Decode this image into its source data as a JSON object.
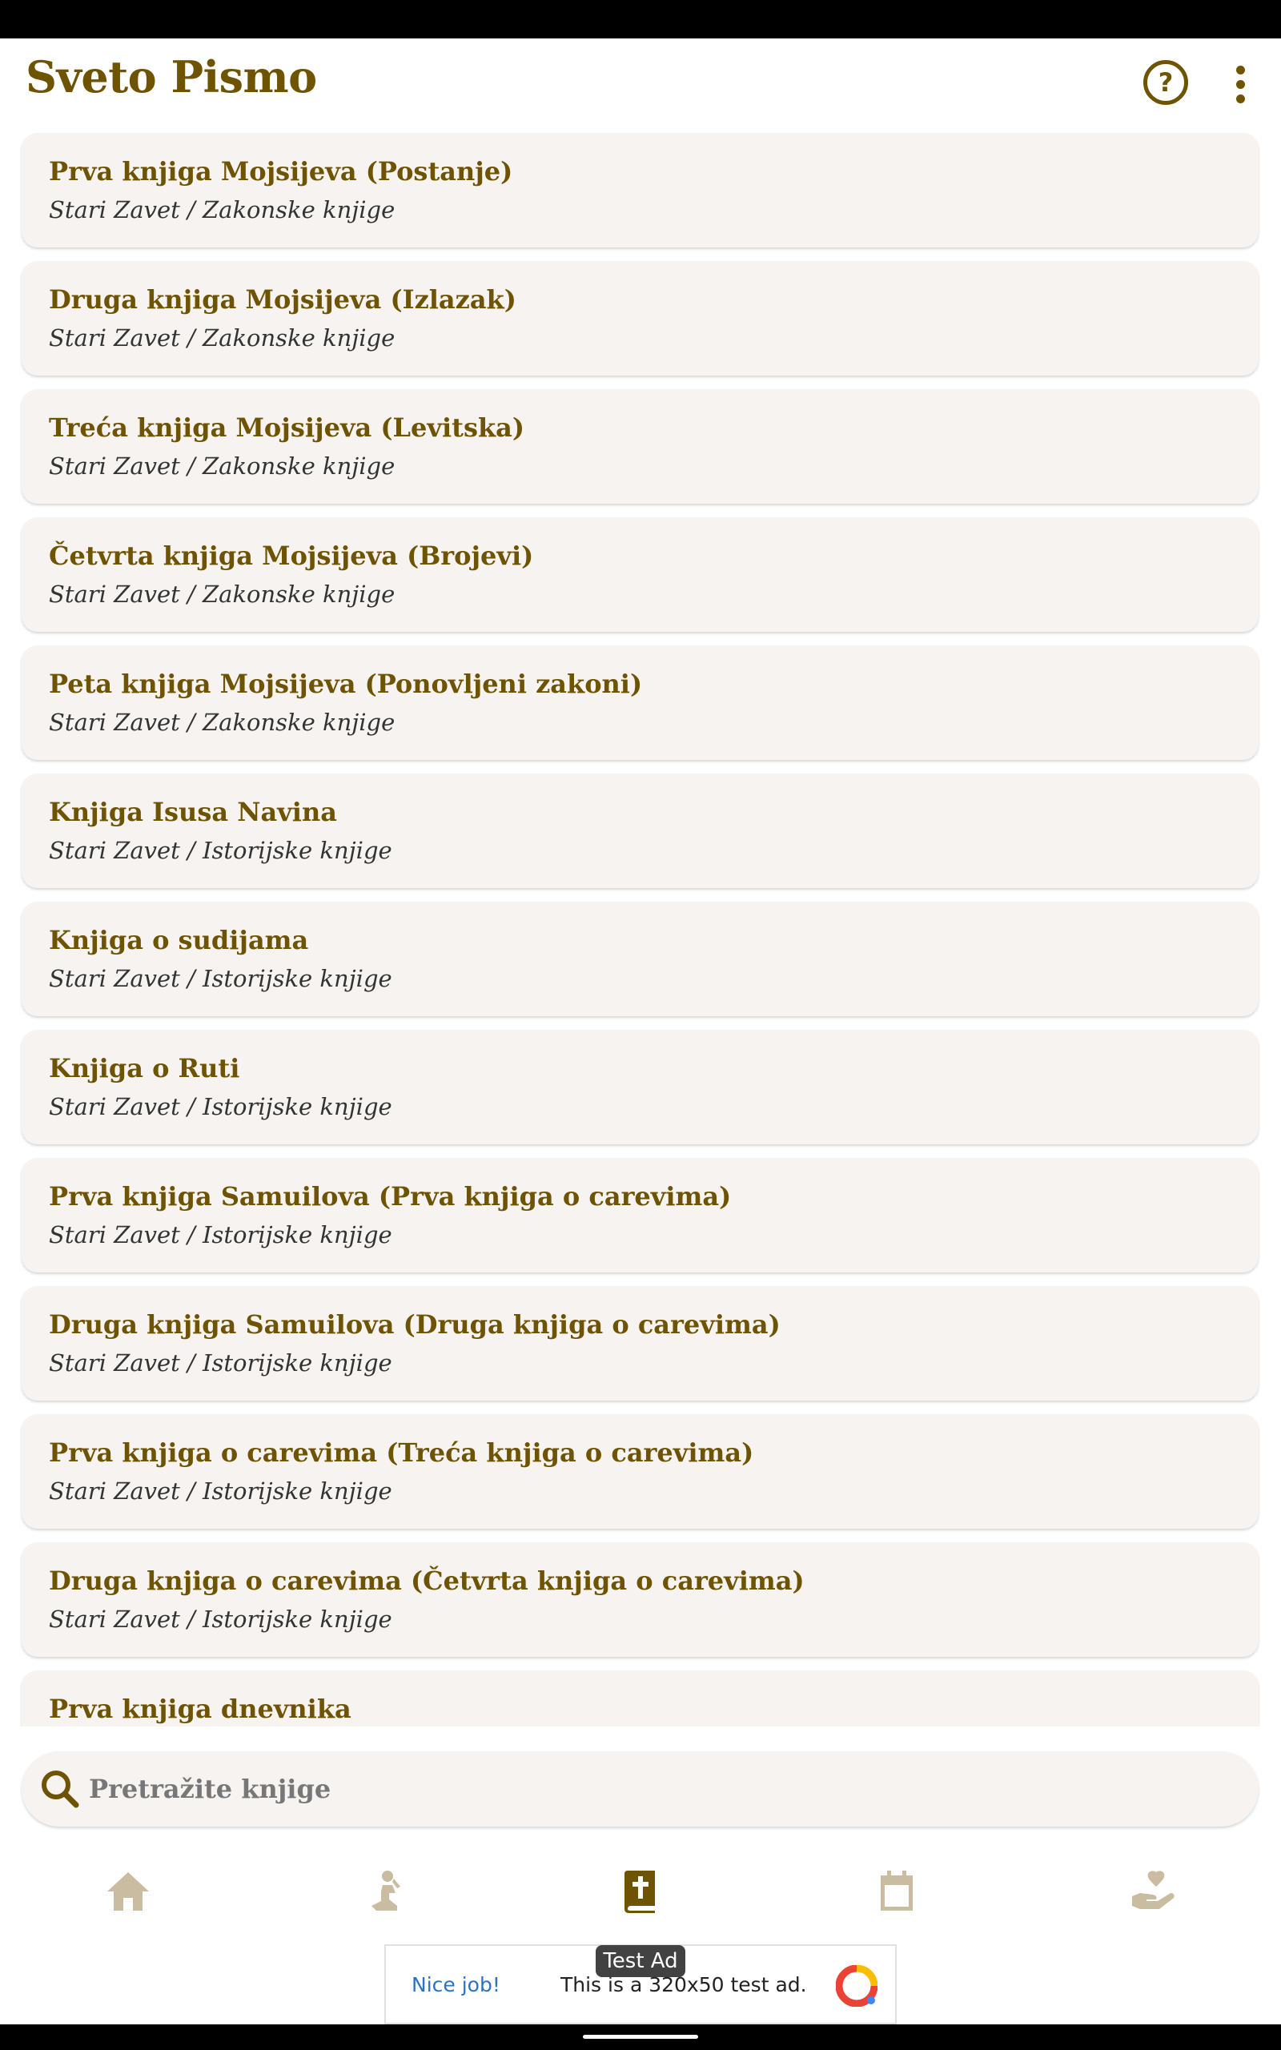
{
  "app_bar": {
    "title": "Sveto Pismo",
    "help_icon": "help-circle-icon",
    "more_icon": "more-vertical-icon"
  },
  "books": [
    {
      "title": "Prva knjiga Mojsijeva (Postanje)",
      "subtitle": "Stari Zavet / Zakonske knjige"
    },
    {
      "title": "Druga knjiga Mojsijeva (Izlazak)",
      "subtitle": "Stari Zavet / Zakonske knjige"
    },
    {
      "title": "Treća knjiga Mojsijeva (Levitska)",
      "subtitle": "Stari Zavet / Zakonske knjige"
    },
    {
      "title": "Četvrta knjiga Mojsijeva (Brojevi)",
      "subtitle": "Stari Zavet / Zakonske knjige"
    },
    {
      "title": "Peta knjiga Mojsijeva (Ponovljeni zakoni)",
      "subtitle": "Stari Zavet / Zakonske knjige"
    },
    {
      "title": "Knjiga Isusa Navina",
      "subtitle": "Stari Zavet / Istorijske knjige"
    },
    {
      "title": "Knjiga o sudijama",
      "subtitle": "Stari Zavet / Istorijske knjige"
    },
    {
      "title": "Knjiga o Ruti",
      "subtitle": "Stari Zavet / Istorijske knjige"
    },
    {
      "title": "Prva knjiga Samuilova (Prva knjiga o carevima)",
      "subtitle": "Stari Zavet / Istorijske knjige"
    },
    {
      "title": "Druga knjiga Samuilova (Druga knjiga o carevima)",
      "subtitle": "Stari Zavet / Istorijske knjige"
    },
    {
      "title": "Prva knjiga o carevima (Treća knjiga o carevima)",
      "subtitle": "Stari Zavet / Istorijske knjige"
    },
    {
      "title": "Druga knjiga o carevima (Četvrta knjiga o carevima)",
      "subtitle": "Stari Zavet / Istorijske knjige"
    },
    {
      "title": "Prva knjiga dnevnika",
      "subtitle": ""
    }
  ],
  "search": {
    "placeholder": "Pretražite knjige",
    "value": ""
  },
  "bottom_nav": {
    "items": [
      {
        "icon": "home-icon",
        "active": false
      },
      {
        "icon": "praying-person-icon",
        "active": false
      },
      {
        "icon": "bible-book-icon",
        "active": true
      },
      {
        "icon": "calendar-icon",
        "active": false
      },
      {
        "icon": "hand-heart-icon",
        "active": false
      }
    ]
  },
  "ad": {
    "tooltip": "Test Ad",
    "nice_job": "Nice job!",
    "text": "This is a 320x50 test ad."
  },
  "colors": {
    "accent": "#6e5300",
    "card_bg": "#f6f3f0",
    "nav_inactive": "#c9bca0",
    "ad_link": "#2a73c7"
  }
}
